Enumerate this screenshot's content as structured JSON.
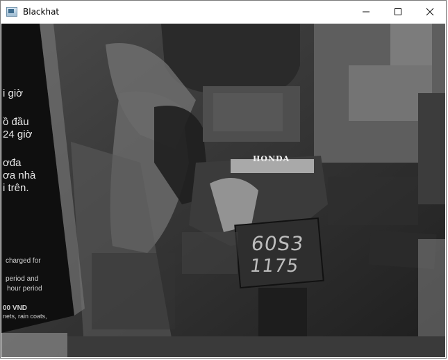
{
  "window": {
    "title": "Blackhat",
    "app_icon": "window-app-icon",
    "controls": {
      "minimize_icon": "minimize-icon",
      "maximize_icon": "maximize-icon",
      "close_icon": "close-icon"
    }
  },
  "image": {
    "description_icon": "camera-frame",
    "poster_lines": [
      "i giờ",
      "ồ đầu",
      "24 giờ",
      "ơđa",
      "ơa nhà",
      "i trên."
    ],
    "poster_english": [
      "charged for",
      "period and",
      "hour  period",
      "00 VND",
      "nets, rain coats,"
    ],
    "brand_text": "HONDA",
    "plate_top": "60S3",
    "plate_bottom": "1175"
  }
}
